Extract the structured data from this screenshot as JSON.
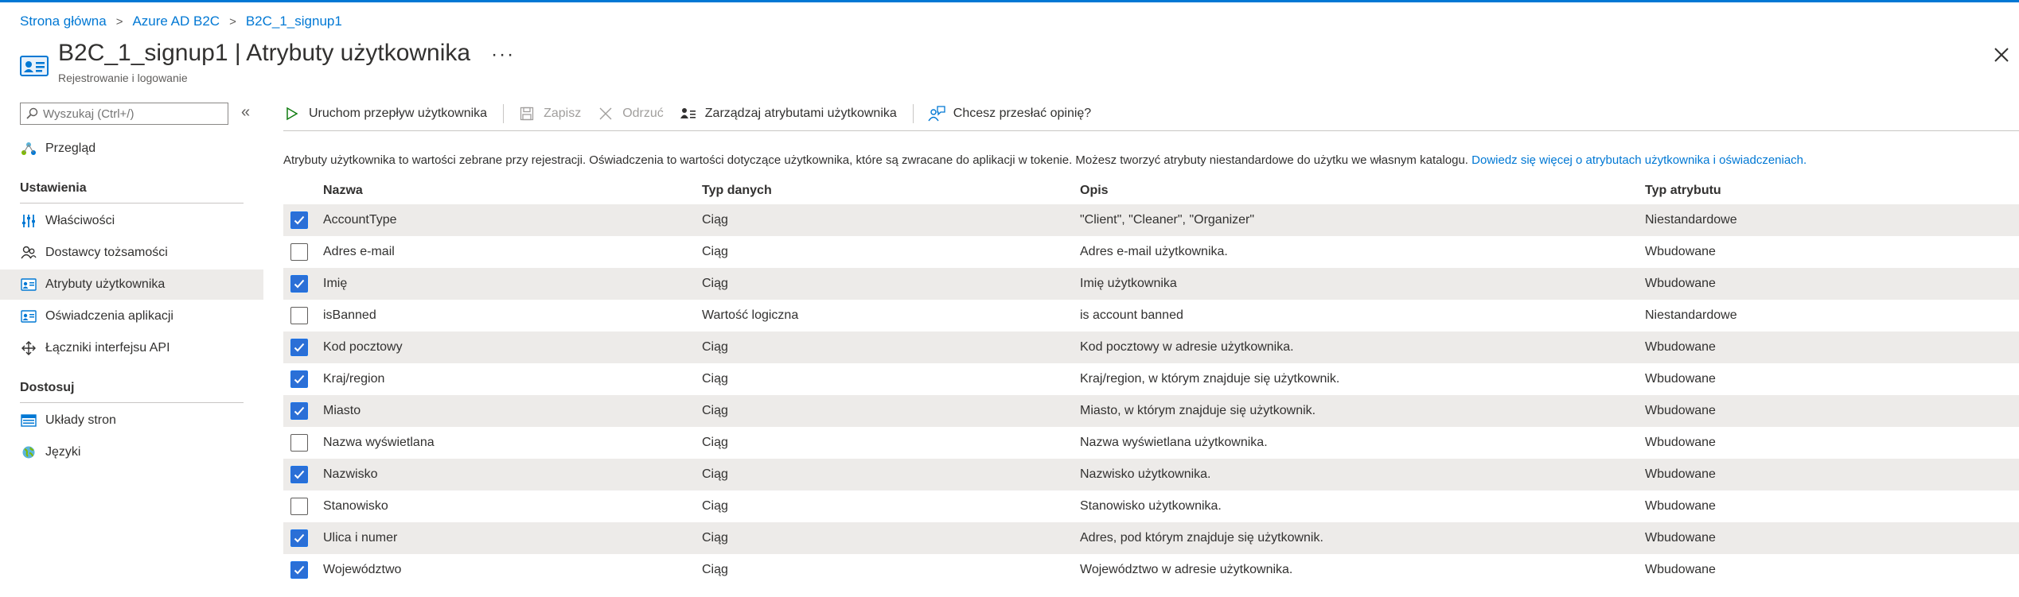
{
  "breadcrumb": [
    "Strona główna",
    "Azure AD B2C",
    "B2C_1_signup1"
  ],
  "page": {
    "title": "B2C_1_signup1 | Atrybuty użytkownika",
    "ellipsis": "···",
    "subtitle": "Rejestrowanie i logowanie"
  },
  "search": {
    "placeholder": "Wyszukaj (Ctrl+/)"
  },
  "collapse_label": "«",
  "sidebar": {
    "overview": "Przegląd",
    "section_settings": "Ustawienia",
    "settings_items": [
      {
        "label": "Właściwości",
        "icon": "sliders-icon"
      },
      {
        "label": "Dostawcy tożsamości",
        "icon": "people-icon"
      },
      {
        "label": "Atrybuty użytkownika",
        "icon": "contact-card-icon",
        "active": true
      },
      {
        "label": "Oświadczenia aplikacji",
        "icon": "contact-card-icon"
      },
      {
        "label": "Łączniki interfejsu API",
        "icon": "connector-icon"
      }
    ],
    "section_customize": "Dostosuj",
    "customize_items": [
      {
        "label": "Układy stron",
        "icon": "layout-icon"
      },
      {
        "label": "Języki",
        "icon": "globe-icon"
      }
    ]
  },
  "toolbar": {
    "run": "Uruchom przepływ użytkownika",
    "save": "Zapisz",
    "discard": "Odrzuć",
    "manage": "Zarządzaj atrybutami użytkownika",
    "feedback": "Chcesz przesłać opinię?"
  },
  "info": {
    "text": "Atrybuty użytkownika to wartości zebrane przy rejestracji. Oświadczenia to wartości dotyczące użytkownika, które są zwracane do aplikacji w tokenie. Możesz tworzyć atrybuty niestandardowe do użytku we własnym katalogu. ",
    "link": "Dowiedz się więcej o atrybutach użytkownika i oświadczeniach."
  },
  "table": {
    "headers": [
      "Nazwa",
      "Typ danych",
      "Opis",
      "Typ atrybutu"
    ],
    "rows": [
      {
        "checked": true,
        "name": "AccountType",
        "type": "Ciąg",
        "desc": "\"Client\", \"Cleaner\", \"Organizer\"",
        "kind": "Niestandardowe"
      },
      {
        "checked": false,
        "name": "Adres e-mail",
        "type": "Ciąg",
        "desc": "Adres e-mail użytkownika.",
        "kind": "Wbudowane"
      },
      {
        "checked": true,
        "name": "Imię",
        "type": "Ciąg",
        "desc": "Imię użytkownika",
        "kind": "Wbudowane"
      },
      {
        "checked": false,
        "name": "isBanned",
        "type": "Wartość logiczna",
        "desc": "is account banned",
        "kind": "Niestandardowe"
      },
      {
        "checked": true,
        "name": "Kod pocztowy",
        "type": "Ciąg",
        "desc": "Kod pocztowy w adresie użytkownika.",
        "kind": "Wbudowane"
      },
      {
        "checked": true,
        "name": "Kraj/region",
        "type": "Ciąg",
        "desc": "Kraj/region, w którym znajduje się użytkownik.",
        "kind": "Wbudowane"
      },
      {
        "checked": true,
        "name": "Miasto",
        "type": "Ciąg",
        "desc": "Miasto, w którym znajduje się użytkownik.",
        "kind": "Wbudowane"
      },
      {
        "checked": false,
        "name": "Nazwa wyświetlana",
        "type": "Ciąg",
        "desc": "Nazwa wyświetlana użytkownika.",
        "kind": "Wbudowane"
      },
      {
        "checked": true,
        "name": "Nazwisko",
        "type": "Ciąg",
        "desc": "Nazwisko użytkownika.",
        "kind": "Wbudowane"
      },
      {
        "checked": false,
        "name": "Stanowisko",
        "type": "Ciąg",
        "desc": "Stanowisko użytkownika.",
        "kind": "Wbudowane"
      },
      {
        "checked": true,
        "name": "Ulica i numer",
        "type": "Ciąg",
        "desc": "Adres, pod którym znajduje się użytkownik.",
        "kind": "Wbudowane"
      },
      {
        "checked": true,
        "name": "Województwo",
        "type": "Ciąg",
        "desc": "Województwo w adresie użytkownika.",
        "kind": "Wbudowane"
      }
    ]
  },
  "colors": {
    "accent": "#0078d4",
    "checkbox": "#2b6fd6",
    "row_shade": "#edebe9"
  }
}
